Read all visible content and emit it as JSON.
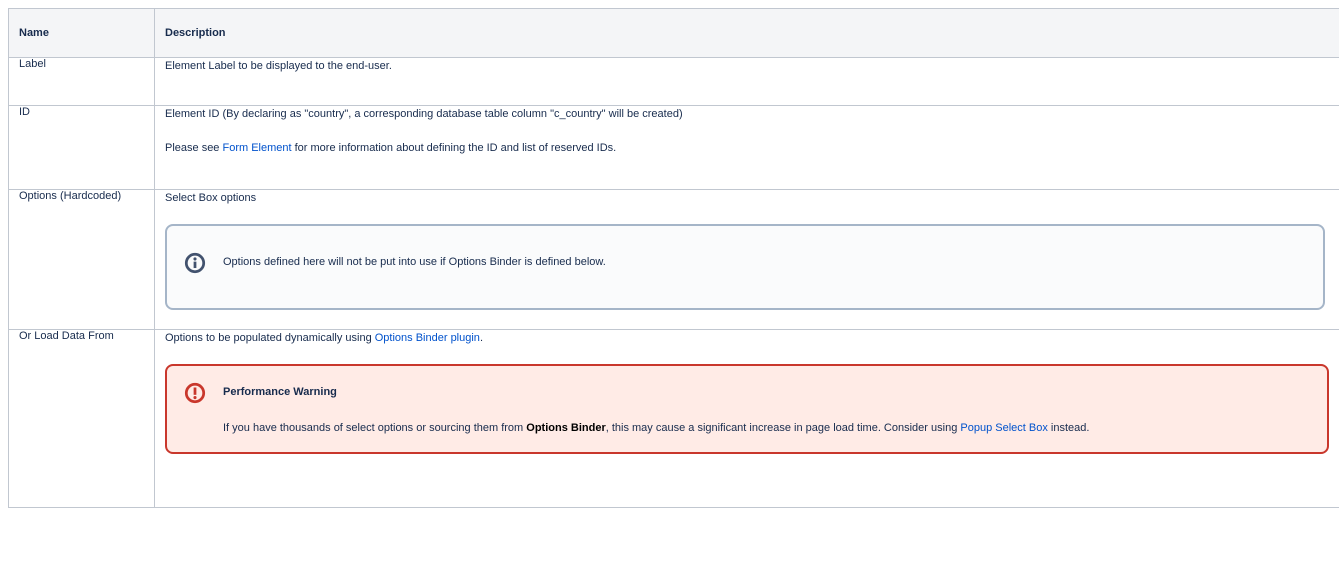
{
  "table": {
    "headers": {
      "name": "Name",
      "description": "Description"
    },
    "rows": {
      "label": {
        "name": "Label",
        "desc": "Element Label to be displayed to the end-user."
      },
      "id": {
        "name": "ID",
        "desc1": "Element ID (By declaring as \"country\", a corresponding database table column \"c_country\" will be created)",
        "desc2_pre": "Please see ",
        "desc2_link": "Form Element",
        "desc2_post": " for more information about defining the ID and list of reserved IDs."
      },
      "options": {
        "name": "Options (Hardcoded)",
        "desc": "Select Box options",
        "info_panel_text": "Options defined here will not be put into use if Options Binder is defined below."
      },
      "load": {
        "name": "Or Load Data From",
        "desc_pre": "Options to be populated dynamically using ",
        "desc_link": "Options Binder plugin",
        "desc_post": ".",
        "warning_title": "Performance Warning",
        "warning_pre": "If you have thousands of select options or sourcing them from ",
        "warning_bold": "Options Binder",
        "warning_mid": ", this may cause a significant increase in page load time. Consider using ",
        "warning_link": "Popup Select Box",
        "warning_post": " instead."
      }
    }
  },
  "colors": {
    "link": "#0052cc",
    "info_border": "#a5b5c8",
    "info_icon": "#42526e",
    "warn_border": "#c9372c",
    "warn_bg": "#ffebe6",
    "warn_icon": "#c9372c",
    "header_bg": "#f4f5f7",
    "grid": "#c1c7d0"
  },
  "icons": {
    "info": "info-icon",
    "warning": "warning-icon"
  }
}
